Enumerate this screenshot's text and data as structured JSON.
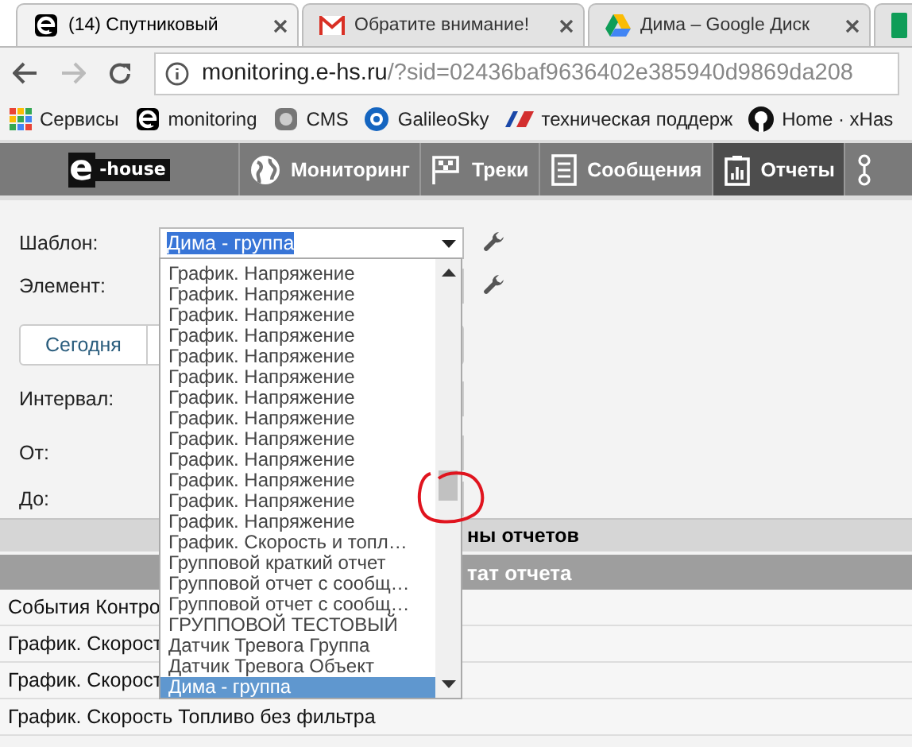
{
  "browser": {
    "tabs": [
      {
        "kind": "ehouse",
        "title": "(14) Спутниковый",
        "selected": true
      },
      {
        "kind": "gmail",
        "title": "Обратите внимание!",
        "selected": false
      },
      {
        "kind": "drive",
        "title": "Дима – Google Диск",
        "selected": false
      },
      {
        "kind": "sheets"
      }
    ],
    "address": {
      "host": "monitoring.e-hs.ru",
      "path": "/?sid=02436baf9636402e385940d9869da208"
    },
    "bookmarks": [
      {
        "kind": "apps",
        "label": "Сервисы"
      },
      {
        "kind": "ehouse",
        "label": "monitoring"
      },
      {
        "kind": "cms",
        "label": "CMS"
      },
      {
        "kind": "galileo",
        "label": "GalileoSky"
      },
      {
        "kind": "support",
        "label": "техническая поддерж"
      },
      {
        "kind": "github",
        "label": "Home · xHas"
      }
    ]
  },
  "navbar": {
    "logo": {
      "mark": "e",
      "word": "-house"
    },
    "items": [
      {
        "kind": "globe",
        "label": "Мониторинг",
        "selected": false
      },
      {
        "kind": "flag",
        "label": "Треки",
        "selected": false
      },
      {
        "kind": "messages",
        "label": "Сообщения",
        "selected": false
      },
      {
        "kind": "reports",
        "label": "Отчеты",
        "selected": true
      },
      {
        "kind": "more"
      }
    ]
  },
  "form": {
    "template_label": "Шаблон:",
    "template_value": "Дима - группа",
    "element_label": "Элемент:",
    "period_button": "Сегодня",
    "interval_label": "Интервал:",
    "from_label": "От:",
    "to_label": "До:"
  },
  "dropdown": {
    "items": [
      {
        "label": "График. Напряжение",
        "selected": false
      },
      {
        "label": "График. Напряжение",
        "selected": false
      },
      {
        "label": "График. Напряжение",
        "selected": false
      },
      {
        "label": "График. Напряжение",
        "selected": false
      },
      {
        "label": "График. Напряжение",
        "selected": false
      },
      {
        "label": "График. Напряжение",
        "selected": false
      },
      {
        "label": "График. Напряжение",
        "selected": false
      },
      {
        "label": "График. Напряжение",
        "selected": false
      },
      {
        "label": "График. Напряжение",
        "selected": false
      },
      {
        "label": "График. Напряжение",
        "selected": false
      },
      {
        "label": "График. Напряжение",
        "selected": false
      },
      {
        "label": "График. Напряжение",
        "selected": false
      },
      {
        "label": "График. Напряжение",
        "selected": false
      },
      {
        "label": "График. Скорость и топл…",
        "selected": false
      },
      {
        "label": "Групповой краткий отчет",
        "selected": false
      },
      {
        "label": "Групповой отчет с сообщ…",
        "selected": false
      },
      {
        "label": "Групповой отчет с сообщ…",
        "selected": false
      },
      {
        "label": "ГРУППОВОЙ ТЕСТОВЫЙ",
        "selected": false
      },
      {
        "label": "Датчик Тревога Группа",
        "selected": false
      },
      {
        "label": "Датчик Тревога Объект",
        "selected": false
      },
      {
        "label": "Дима - группа",
        "selected": true
      }
    ]
  },
  "templates_header": "ны отчетов",
  "result_header": "тат отчета",
  "rows": [
    "События Контро",
    "График. Скорост",
    "График. Скорост",
    "График. Скорость Топливо без фильтра"
  ]
}
